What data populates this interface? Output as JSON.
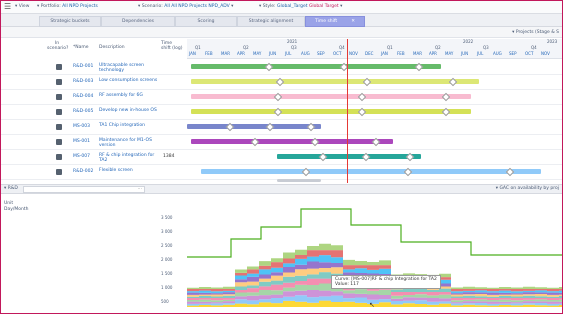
{
  "toolbar": {
    "view_label": "View",
    "portfolio_label": "Portfolio:",
    "portfolio_value": "All NPD Projects",
    "scenario_label": "Scenario:",
    "scenario_value": "All All NPD Projects NPD_ADV",
    "style_label": "Style:",
    "style_value": "Global_Target",
    "style_extra": "Global Target"
  },
  "tabs": [
    {
      "label": "Strategic buckets"
    },
    {
      "label": "Dependencies"
    },
    {
      "label": "Scoring"
    },
    {
      "label": "Strategic alignment"
    },
    {
      "label": "Time shift"
    }
  ],
  "subheader": {
    "right_label": "Projects (Stage & S"
  },
  "columns": {
    "in_scenario": "In scenario?",
    "name": "*Name",
    "description": "Description",
    "time_shift": "Time shift (log)"
  },
  "years": [
    "2021",
    "2022",
    "2023"
  ],
  "months": [
    "JAN",
    "FEB",
    "MAR",
    "APR",
    "MAY",
    "JUN",
    "JUL",
    "AUG",
    "SEP",
    "OCT",
    "NOV",
    "DEC",
    "JAN",
    "FEB",
    "MAR",
    "APR",
    "MAY",
    "JUN",
    "JUL",
    "AUG",
    "SEP",
    "OCT",
    "NOV"
  ],
  "quarters": [
    "Q1",
    "Q2",
    "Q3",
    "Q4",
    "Q1",
    "Q2",
    "Q3",
    "Q4"
  ],
  "rows": [
    {
      "name": "R&D-001",
      "description": "Ultracapable screen technology",
      "shift": "",
      "color": "#66bb6a"
    },
    {
      "name": "R&D-003",
      "description": "Low consumption screens",
      "shift": "",
      "color": "#dce775"
    },
    {
      "name": "R&D-004",
      "description": "RF assembly for 6G",
      "shift": "",
      "color": "#f8bbd0"
    },
    {
      "name": "R&D-005",
      "description": "Develop new in-house OS",
      "shift": "",
      "color": "#d4e157"
    },
    {
      "name": "MS-003",
      "description": "TA1 Chip integration",
      "shift": "",
      "color": "#7986cb"
    },
    {
      "name": "MS-001",
      "description": "Maintenance for M1-OS version",
      "shift": "",
      "color": "#ab47bc"
    },
    {
      "name": "MS-007",
      "description": "RF & chip integration for TA2",
      "shift": "1384",
      "color": "#26a69a"
    },
    {
      "name": "R&D-002",
      "description": "Flexible screen",
      "shift": "",
      "color": "#90caf9"
    }
  ],
  "bottom_panel": {
    "left_label": "R&D",
    "right_label": "GAC on availability by proj",
    "unit_label": "Unit",
    "unit_value": "Day/Month",
    "y_ticks": [
      "3 500",
      "3 000",
      "2 500",
      "2 000",
      "1 500",
      "1 000",
      "500"
    ]
  },
  "tooltip": {
    "curve": "Curve: [MS-007]RF & chip Integration for TA2",
    "value": "Value: 117"
  },
  "colors": {
    "accent": "#c2185b",
    "active_tab": "#9aa3e8",
    "today_line": "#e53935",
    "capacity_line": "#4caf1f"
  }
}
